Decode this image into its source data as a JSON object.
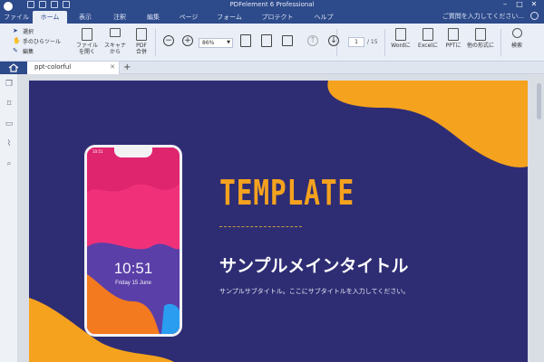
{
  "window": {
    "title": "PDFelement 6 Professional"
  },
  "menu": {
    "items": [
      "ファイル",
      "ホーム",
      "表示",
      "注釈",
      "編集",
      "ページ",
      "フォーム",
      "プロテクト",
      "ヘルプ"
    ],
    "help_search": "ご質問を入力してください..."
  },
  "ribbon": {
    "tools": [
      "選択",
      "手のひらツール",
      "編集"
    ],
    "open_file": "ファイル\nを開く",
    "scanner": "スキャナ\nから",
    "pdf_merge": "PDF\n合併",
    "zoom": "86%",
    "page_current": "1",
    "page_total": "/ 15",
    "to_word": "Wordに",
    "to_excel": "Excelに",
    "to_ppt": "PPTに",
    "to_other": "他の形式に",
    "search": "検索"
  },
  "tabs": {
    "document": "ppt-colorful"
  },
  "page": {
    "heading": "TEMPLATE",
    "main_title": "サンプルメインタイトル",
    "subtitle": "サンプルサブタイトル。ここにサブタイトルを入力してください。",
    "phone_status": "10:51",
    "phone_time": "10:51",
    "phone_date": "Friday 15 June"
  },
  "colors": {
    "titlebar": "#2d4a8a",
    "ribbon": "#e9eef7",
    "slide_background": "#2e2d74",
    "accent_orange": "#f5a21e",
    "phone_pink": "#f0317a"
  }
}
